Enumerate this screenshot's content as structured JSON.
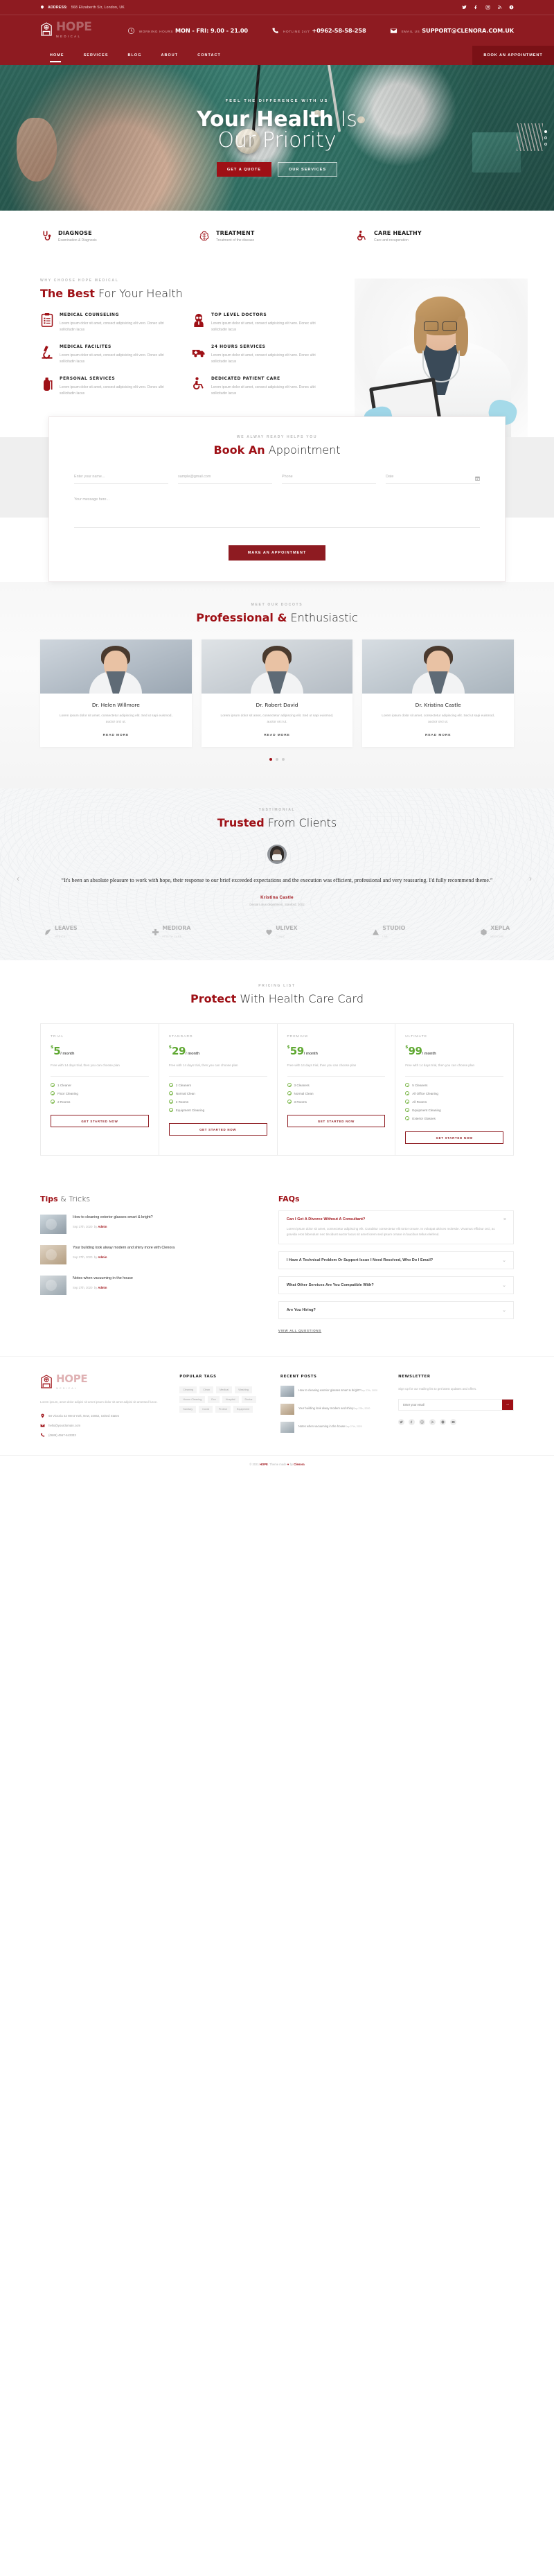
{
  "topbar": {
    "address_label": "ADDRESS:",
    "address": " 568 Elizaberth Str, London, UK",
    "socials": [
      "twitter-icon",
      "facebook-icon",
      "instagram-icon",
      "rss-icon",
      "vk-icon"
    ]
  },
  "header": {
    "brand": "HOPE",
    "brand_sub": "MEDICAL",
    "info": [
      {
        "label": "WORKING HOURS",
        "value": "MON - FRI: 9.00 - 21.00",
        "icon": "clock-icon"
      },
      {
        "label": "HOTLINE 24/7",
        "value": "+0962-58-58-258",
        "icon": "phone-icon"
      },
      {
        "label": "EMAIL US",
        "value": "SUPPORT@CLENORA.COM.UK",
        "icon": "mail-icon"
      }
    ]
  },
  "nav": {
    "items": [
      "HOME",
      "SERVICES",
      "BLOG",
      "ABOUT",
      "CONTACT"
    ],
    "active": "HOME",
    "cta": "BOOK AN APPOINTMENT"
  },
  "hero": {
    "kicker": "FEEL THE DIFFERENCE WITH US",
    "title_bold": "Your Health",
    "title_light": " Is",
    "title_line2": "Our Priority",
    "btn_primary": "GET A QUOTE",
    "btn_secondary": "OUR SERVICES"
  },
  "strip": [
    {
      "title": "DIAGNOSE",
      "desc": "Examination & Diagnosis",
      "icon": "stethoscope-icon"
    },
    {
      "title": "TREATMENT",
      "desc": "Treatment of the disease",
      "icon": "brain-icon"
    },
    {
      "title": "CARE HEALTHY",
      "desc": "Care and recuperation",
      "icon": "wheelchair-icon"
    }
  ],
  "best": {
    "kicker": "WHY CHOOSE HOPE MEDICAL",
    "title_bold": "The Best",
    "title_light": " For Your Health",
    "features": [
      {
        "title": "MEDICAL COUNSELING",
        "desc": "Lorem ipsum dolor sit amet, consect adipisicing elit vero. Donec ultri sollicitudin lacus",
        "icon": "clipboard-icon"
      },
      {
        "title": "TOP LEVEL DOCTORS",
        "desc": "Lorem ipsum dolor sit amet, consect adipisicing elit vero. Donec ultri sollicitudin lacus",
        "icon": "doctor-icon"
      },
      {
        "title": "MEDICAL FACILITES",
        "desc": "Lorem ipsum dolor sit amet, consect adipisicing elit vero. Donec ultri sollicitudin lacus",
        "icon": "microscope-icon"
      },
      {
        "title": "24 HOURS SERVICES",
        "desc": "Lorem ipsum dolor sit amet, consect adipisicing elit vero. Donec ultri sollicitudin lacus",
        "icon": "ambulance-icon"
      },
      {
        "title": "PERSONAL SERVICES",
        "desc": "Lorem ipsum dolor sit amet, consect adipisicing elit vero. Donec ultri sollicitudin lacus",
        "icon": "oxygen-tank-icon"
      },
      {
        "title": "DEDICATED PATIENT CARE",
        "desc": "Lorem ipsum dolor sit amet, consect adipisicing elit vero. Donec ultri sollicitudin lacus",
        "icon": "wheelchair-icon"
      }
    ]
  },
  "appointment": {
    "kicker": "WE ALWAY READY HELPS YOU",
    "title_bold": "Book An",
    "title_light": " Appointment",
    "fields": {
      "name_placeholder": "Enter your name...",
      "email_placeholder": "sample@gmail.com",
      "phone_placeholder": "Phone",
      "date_placeholder": "Date",
      "message_placeholder": "Your message here..."
    },
    "submit": "MAKE AN APPOINTMENT"
  },
  "doctors": {
    "kicker": "MEET OUR DOCOTS",
    "title_bold": "Professional &",
    "title_light": " Enthusiastic",
    "cards": [
      {
        "name": "Dr. Helen Willmore",
        "desc": "Lorem ipsum dolor sit amet, consectetur adipiscing elit. Sed ut sapi euismod, auctor orci ut.",
        "more": "READ MORE"
      },
      {
        "name": "Dr. Robert David",
        "desc": "Lorem ipsum dolor sit amet, consectetur adipiscing elit. Sed ut sapi euismod, auctor orci ut.",
        "more": "READ MORE"
      },
      {
        "name": "Dr. Kristina Castle",
        "desc": "Lorem ipsum dolor sit amet, consectetur adipiscing elit. Sed ut sapi euismod, auctor orci ut.",
        "more": "READ MORE"
      }
    ],
    "dots": 3,
    "active_dot": 1
  },
  "testimonial": {
    "kicker": "TESTIMONIAL",
    "title_bold": "Trusted",
    "title_light": " From Clients",
    "quote": "“It's been an absolute pleasure to work with hope, their response to our brief exceeded expectations and the execution was efficient, professional and very reassuring. I'd fully recommend theme.”",
    "author": "Kristina Castle",
    "role": "Dental Lotus department, Stanford, 2002",
    "prev": "‹",
    "next": "›",
    "brands": [
      {
        "name": "LEAVES",
        "sub": "MEDICAL",
        "icon": "leaf-icon"
      },
      {
        "name": "MEDIORA",
        "sub": "HEALTH CARE",
        "icon": "cross-icon"
      },
      {
        "name": "ULIVEX",
        "sub": "CLINIC",
        "icon": "heart-icon"
      },
      {
        "name": "STUDIO",
        "sub": "LAB",
        "icon": "triangle-icon"
      },
      {
        "name": "XEPLA",
        "sub": "MEDICINE",
        "icon": "hex-icon"
      }
    ]
  },
  "pricing": {
    "kicker": "PRICING LIST",
    "title_bold": "Protect",
    "title_light": " With Health Care Card",
    "plans": [
      {
        "name": "TRIAL",
        "currency": "$",
        "price": "5",
        "per": "/ month",
        "desc": "Free with 14 days trial, then you can choose plan",
        "features": [
          "1 Cleaner",
          "Floor Cleaning",
          "2 Rooms"
        ],
        "cta": "GET STARTED NOW"
      },
      {
        "name": "STANDARD",
        "currency": "$",
        "price": "29",
        "per": "/ month",
        "desc": "Free with 14 days trial, then you can choose plan",
        "features": [
          "2 Cleaners",
          "Normal Clean",
          "3 Rooms",
          "Equipment Cleaning"
        ],
        "cta": "GET STARTED NOW"
      },
      {
        "name": "PREMIUM",
        "currency": "$",
        "price": "59",
        "per": "/ month",
        "desc": "Free with 14 days trial, then you can choose plan",
        "features": [
          "3 Cleaners",
          "Normal Clean",
          "3 Rooms"
        ],
        "cta": "GET STARTED NOW"
      },
      {
        "name": "ULTIMATE",
        "currency": "$",
        "price": "99",
        "per": "/ month",
        "desc": "Free with 14 days trial, then you can choose plan",
        "features": [
          "5 Cleaners",
          "All Office Cleaning",
          "All Rooms",
          "Equipment Cleaning",
          "Exterior Glasses"
        ],
        "cta": "GET STARTED NOW"
      }
    ]
  },
  "tips": {
    "title_bold": "Tips",
    "title_light": " & Tricks",
    "posts": [
      {
        "title": "How to cleaning exterior glasses smart & bright?",
        "date": "Sep 27th, 2020",
        "by": "by ",
        "author": "Admin"
      },
      {
        "title": "Your building look alway modern and shiny more with Clenora",
        "date": "Sep 27th, 2020",
        "by": "by ",
        "author": "Admin"
      },
      {
        "title": "Notes when vacuuming in the house",
        "date": "Sep 27th, 2020",
        "by": "by ",
        "author": "Admin"
      }
    ]
  },
  "faqs": {
    "title_bold": "FAQs",
    "title_light": "",
    "items": [
      {
        "q": "Can I Get A Divorce Without A Consultant?",
        "a": "Lorem ipsum dolor sit amet, consectetur adipiscing elit. Curabitur consectetur elit tortor ornare. In volutpat ultrices molestie. Vivamus efficitur orci, ac gravida eros bibendum nec tincidunt auctor lacus sit amet lorem sed ipsum ornare in faucibus tellus eleifend.",
        "open": true
      },
      {
        "q": "I Have A Technical Problem Or Support Issue I Need Resolved, Who Do I Email?",
        "a": "",
        "open": false
      },
      {
        "q": "What Other Services Are You Compatible With?",
        "a": "",
        "open": false
      },
      {
        "q": "Are You Hiring?",
        "a": "",
        "open": false
      }
    ],
    "view_all": "VIEW ALL QUESTIONS"
  },
  "footer": {
    "brand": "HOPE",
    "brand_sub": "MEDICAL",
    "desc": "Lorem ipsum, amet dolor adipisi sit amet ipsum dolor sit amet adipisi sit ametsed fusce.",
    "contact": [
      {
        "icon": "pin-icon",
        "text": "68 Victoria 42 West York, New, 10062, United States"
      },
      {
        "icon": "mail-icon",
        "text": "hello@yourdomain.com"
      },
      {
        "icon": "phone-icon",
        "text": "(0689) 4567-643333"
      }
    ],
    "popular_tags_title": "POPULAR TAGS",
    "tags": [
      "Cleaning",
      "Clean",
      "Medical",
      "Washing",
      "House Cleaning",
      "Eco",
      "Hospital",
      "Doctor",
      "Sanitary",
      "Covid",
      "Protect",
      "Equipment"
    ],
    "recent_posts_title": "RECENT POSTS",
    "recent_posts": [
      {
        "title": "How to cleaning exterior glasses smart & bright?",
        "date": "Sep 27th, 2020"
      },
      {
        "title": "Your building look alway modern and shiny",
        "date": "Sep 27th, 2020"
      },
      {
        "title": "Notes when vacuuming in the house",
        "date": "Sep 27th, 2020"
      }
    ],
    "newsletter_title": "NEWSLETTER",
    "newsletter_desc": "Sign up for our mailing list to get latest updates and offers.",
    "newsletter_placeholder": "Enter your email",
    "newsletter_button": "→",
    "socials": [
      "twitter-icon",
      "facebook-icon",
      "instagram-icon",
      "rss-icon",
      "vk-icon",
      "youtube-icon"
    ]
  },
  "copyright": {
    "text_1": "© 2021 ",
    "brand": "HOPE",
    "text_2": ". Theme made ",
    "heart": "♥",
    "text_3": " by ",
    "author": "Clenora"
  }
}
